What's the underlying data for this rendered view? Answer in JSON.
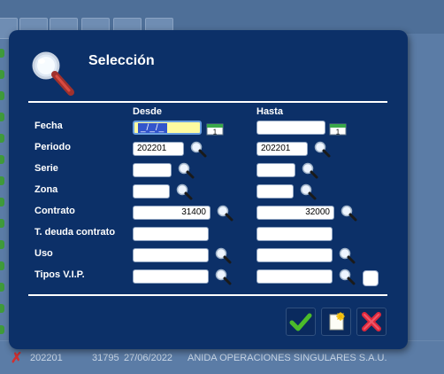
{
  "dialog": {
    "title": "Selección",
    "col_from": "Desde",
    "col_to": "Hasta",
    "rows": [
      {
        "label": "Fecha",
        "from": "_/_/_",
        "to": ""
      },
      {
        "label": "Periodo",
        "from": "202201",
        "to": "202201"
      },
      {
        "label": "Serie",
        "from": "",
        "to": ""
      },
      {
        "label": "Zona",
        "from": "",
        "to": ""
      },
      {
        "label": "Contrato",
        "from": "31400",
        "to": "32000"
      },
      {
        "label": "T. deuda contrato",
        "from": "",
        "to": ""
      },
      {
        "label": "Uso",
        "from": "",
        "to": ""
      },
      {
        "label": "Tipos V.I.P.",
        "from": "",
        "to": ""
      }
    ],
    "calendar_day": "1",
    "vip_checkbox_checked": false
  },
  "background": {
    "bottom_row": {
      "period": "202201",
      "number": "31795",
      "date": "27/06/2022",
      "name": "ANIDA OPERACIONES SINGULARES S.A.U."
    }
  },
  "colors": {
    "dialog_bg": "#0c3068",
    "text": "#ffffff",
    "focus_field": "#fefba0",
    "accept_green": "#4cbb2a",
    "cancel_red": "#e0283c"
  }
}
